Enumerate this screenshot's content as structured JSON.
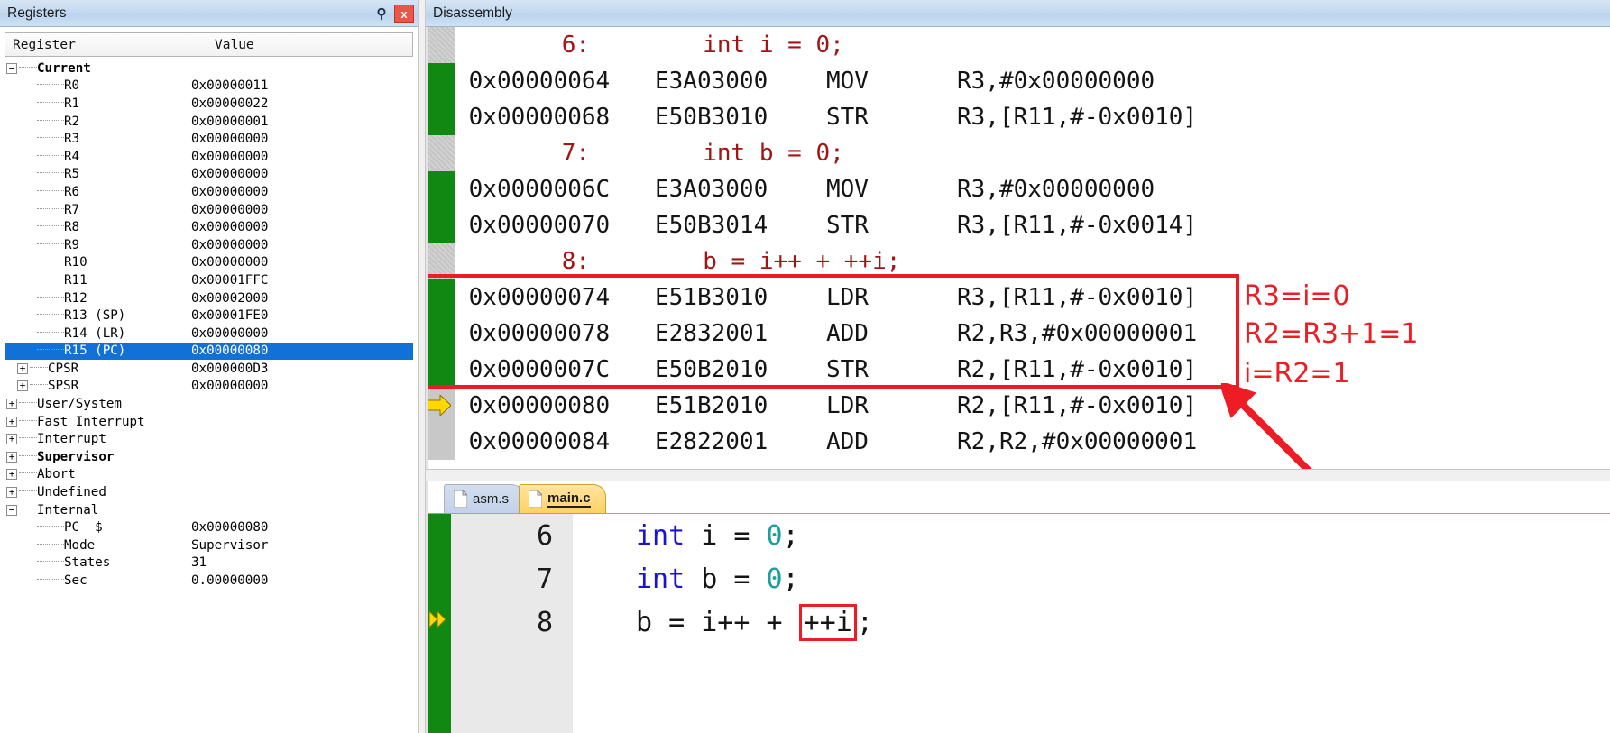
{
  "registers_panel": {
    "title": "Registers",
    "pin_icon": "pin-icon",
    "close_icon": "close-icon",
    "columns": {
      "name": "Register",
      "value": "Value"
    },
    "groups": [
      {
        "label": "Current",
        "expander": "-",
        "bold": true,
        "value": ""
      }
    ],
    "current_registers": [
      {
        "name": "R0",
        "value": "0x00000011"
      },
      {
        "name": "R1",
        "value": "0x00000022"
      },
      {
        "name": "R2",
        "value": "0x00000001"
      },
      {
        "name": "R3",
        "value": "0x00000000"
      },
      {
        "name": "R4",
        "value": "0x00000000"
      },
      {
        "name": "R5",
        "value": "0x00000000"
      },
      {
        "name": "R6",
        "value": "0x00000000"
      },
      {
        "name": "R7",
        "value": "0x00000000"
      },
      {
        "name": "R8",
        "value": "0x00000000"
      },
      {
        "name": "R9",
        "value": "0x00000000"
      },
      {
        "name": "R10",
        "value": "0x00000000"
      },
      {
        "name": "R11",
        "value": "0x00001FFC"
      },
      {
        "name": "R12",
        "value": "0x00002000"
      },
      {
        "name": "R13 (SP)",
        "value": "0x00001FE0"
      },
      {
        "name": "R14 (LR)",
        "value": "0x00000000"
      },
      {
        "name": "R15 (PC)",
        "value": "0x00000080",
        "selected": true
      }
    ],
    "status_registers": [
      {
        "name": "CPSR",
        "value": "0x000000D3",
        "expander": "+"
      },
      {
        "name": "SPSR",
        "value": "0x00000000",
        "expander": "+"
      }
    ],
    "mode_groups": [
      {
        "name": "User/System",
        "expander": "+",
        "bold": false
      },
      {
        "name": "Fast Interrupt",
        "expander": "+",
        "bold": false
      },
      {
        "name": "Interrupt",
        "expander": "+",
        "bold": false
      },
      {
        "name": "Supervisor",
        "expander": "+",
        "bold": true
      },
      {
        "name": "Abort",
        "expander": "+",
        "bold": false
      },
      {
        "name": "Undefined",
        "expander": "+",
        "bold": false
      },
      {
        "name": "Internal",
        "expander": "-",
        "bold": false
      }
    ],
    "internal_items": [
      {
        "name": "PC  $",
        "value": "0x00000080"
      },
      {
        "name": "Mode",
        "value": "Supervisor"
      },
      {
        "name": "States",
        "value": "31"
      },
      {
        "name": "Sec",
        "value": "0.00000000"
      }
    ]
  },
  "disassembly": {
    "title": "Disassembly",
    "lines": [
      {
        "kind": "source",
        "gutter": "grey",
        "num": "6:",
        "text": "int i = 0;"
      },
      {
        "kind": "code",
        "gutter": "green",
        "addr": "0x00000064",
        "opcode": "E3A03000",
        "mnemonic": "MOV",
        "operands": "R3,#0x00000000"
      },
      {
        "kind": "code",
        "gutter": "green",
        "addr": "0x00000068",
        "opcode": "E50B3010",
        "mnemonic": "STR",
        "operands": "R3,[R11,#-0x0010]"
      },
      {
        "kind": "source",
        "gutter": "grey",
        "num": "7:",
        "text": "int b = 0;"
      },
      {
        "kind": "code",
        "gutter": "green",
        "addr": "0x0000006C",
        "opcode": "E3A03000",
        "mnemonic": "MOV",
        "operands": "R3,#0x00000000"
      },
      {
        "kind": "code",
        "gutter": "green",
        "addr": "0x00000070",
        "opcode": "E50B3014",
        "mnemonic": "STR",
        "operands": "R3,[R11,#-0x0014]"
      },
      {
        "kind": "source",
        "gutter": "grey",
        "num": "8:",
        "text": "b = i++ + ++i;"
      },
      {
        "kind": "code",
        "gutter": "green",
        "addr": "0x00000074",
        "opcode": "E51B3010",
        "mnemonic": "LDR",
        "operands": "R3,[R11,#-0x0010]"
      },
      {
        "kind": "code",
        "gutter": "green",
        "addr": "0x00000078",
        "opcode": "E2832001",
        "mnemonic": "ADD",
        "operands": "R2,R3,#0x00000001"
      },
      {
        "kind": "code",
        "gutter": "green",
        "addr": "0x0000007C",
        "opcode": "E50B2010",
        "mnemonic": "STR",
        "operands": "R2,[R11,#-0x0010]"
      },
      {
        "kind": "code",
        "gutter": "pc",
        "addr": "0x00000080",
        "opcode": "E51B2010",
        "mnemonic": "LDR",
        "operands": "R2,[R11,#-0x0010]"
      },
      {
        "kind": "code",
        "gutter": "plain",
        "addr": "0x00000084",
        "opcode": "E2822001",
        "mnemonic": "ADD",
        "operands": "R2,R2,#0x00000001"
      }
    ],
    "annotations": [
      {
        "text": "R3=i=0",
        "name": "annotation-r3"
      },
      {
        "text": "R2=R3+1=1",
        "name": "annotation-r2"
      },
      {
        "text": "i=R2=1",
        "name": "annotation-i"
      }
    ],
    "annotation_color": "#ee1c24"
  },
  "editor": {
    "tabs": [
      {
        "label": "asm.s",
        "active": false
      },
      {
        "label": "main.c",
        "active": true
      }
    ],
    "lines": [
      {
        "num": "6",
        "tokens": [
          {
            "t": "int",
            "c": "kw"
          },
          {
            "t": " i = ",
            "c": "plain"
          },
          {
            "t": "0",
            "c": "num"
          },
          {
            "t": ";",
            "c": "plain"
          }
        ]
      },
      {
        "num": "7",
        "tokens": [
          {
            "t": "int",
            "c": "kw"
          },
          {
            "t": " b = ",
            "c": "plain"
          },
          {
            "t": "0",
            "c": "num"
          },
          {
            "t": ";",
            "c": "plain"
          }
        ]
      },
      {
        "num": "8",
        "current": true,
        "tokens": [
          {
            "t": "b = i++ + ",
            "c": "plain"
          },
          {
            "t": "++i",
            "c": "plain",
            "boxed": true
          },
          {
            "t": ";",
            "c": "plain"
          }
        ]
      }
    ]
  }
}
